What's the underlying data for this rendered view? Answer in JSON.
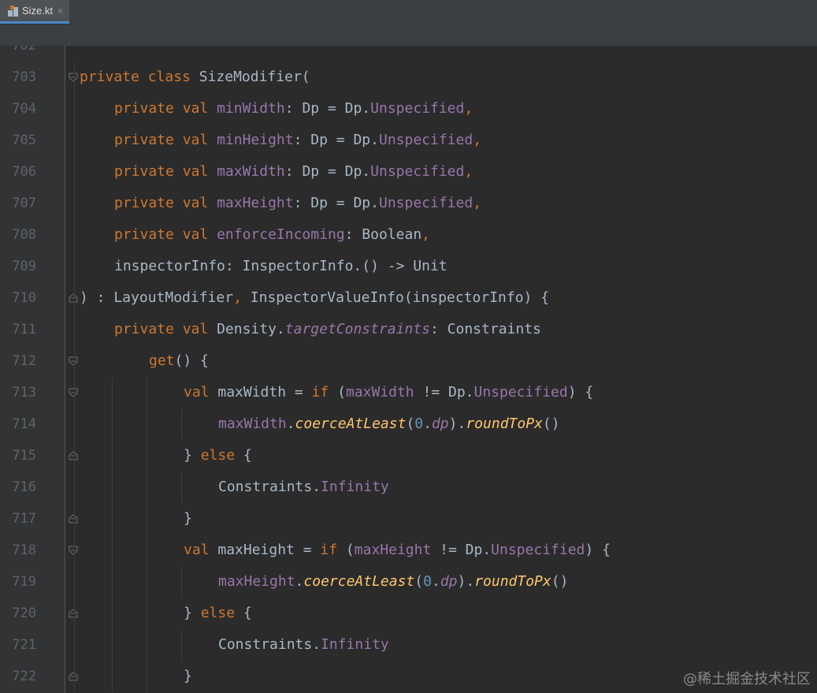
{
  "tab": {
    "filename": "Size.kt",
    "close_glyph": "×",
    "icon": "kotlin-file-icon"
  },
  "colors": {
    "keyword": "#cc7832",
    "property": "#9876aa",
    "function_italic": "#ffc66d",
    "plain": "#a9b7c6",
    "number": "#6897bb",
    "line_number": "#606366"
  },
  "watermark": "@稀土掘金技术社区",
  "editor": {
    "partial_top_line_number": "702",
    "lines": [
      {
        "number": "703",
        "indent": 0,
        "fold": "open",
        "tokens": [
          {
            "t": "private ",
            "c": "kw"
          },
          {
            "t": "class ",
            "c": "kw"
          },
          {
            "t": "SizeModifier(",
            "c": "pl"
          }
        ]
      },
      {
        "number": "704",
        "indent": 1,
        "fold": "",
        "tokens": [
          {
            "t": "private ",
            "c": "kw"
          },
          {
            "t": "val ",
            "c": "kw"
          },
          {
            "t": "minWidth",
            "c": "pr"
          },
          {
            "t": ": Dp = Dp.",
            "c": "pl"
          },
          {
            "t": "Unspecified",
            "c": "pr"
          },
          {
            "t": ",",
            "c": "kw"
          }
        ]
      },
      {
        "number": "705",
        "indent": 1,
        "fold": "",
        "tokens": [
          {
            "t": "private ",
            "c": "kw"
          },
          {
            "t": "val ",
            "c": "kw"
          },
          {
            "t": "minHeight",
            "c": "pr"
          },
          {
            "t": ": Dp = Dp.",
            "c": "pl"
          },
          {
            "t": "Unspecified",
            "c": "pr"
          },
          {
            "t": ",",
            "c": "kw"
          }
        ]
      },
      {
        "number": "706",
        "indent": 1,
        "fold": "",
        "tokens": [
          {
            "t": "private ",
            "c": "kw"
          },
          {
            "t": "val ",
            "c": "kw"
          },
          {
            "t": "maxWidth",
            "c": "pr"
          },
          {
            "t": ": Dp = Dp.",
            "c": "pl"
          },
          {
            "t": "Unspecified",
            "c": "pr"
          },
          {
            "t": ",",
            "c": "kw"
          }
        ]
      },
      {
        "number": "707",
        "indent": 1,
        "fold": "",
        "tokens": [
          {
            "t": "private ",
            "c": "kw"
          },
          {
            "t": "val ",
            "c": "kw"
          },
          {
            "t": "maxHeight",
            "c": "pr"
          },
          {
            "t": ": Dp = Dp.",
            "c": "pl"
          },
          {
            "t": "Unspecified",
            "c": "pr"
          },
          {
            "t": ",",
            "c": "kw"
          }
        ]
      },
      {
        "number": "708",
        "indent": 1,
        "fold": "",
        "tokens": [
          {
            "t": "private ",
            "c": "kw"
          },
          {
            "t": "val ",
            "c": "kw"
          },
          {
            "t": "enforceIncoming",
            "c": "pr"
          },
          {
            "t": ": Boolean",
            "c": "pl"
          },
          {
            "t": ",",
            "c": "kw"
          }
        ]
      },
      {
        "number": "709",
        "indent": 1,
        "fold": "",
        "tokens": [
          {
            "t": "inspectorInfo: InspectorInfo.() -> Unit",
            "c": "pl"
          }
        ]
      },
      {
        "number": "710",
        "indent": 0,
        "fold": "close",
        "tokens": [
          {
            "t": ") : LayoutModifier",
            "c": "pl"
          },
          {
            "t": ", ",
            "c": "kw"
          },
          {
            "t": "InspectorValueInfo(inspectorInfo) {",
            "c": "pl"
          }
        ]
      },
      {
        "number": "711",
        "indent": 1,
        "fold": "",
        "tokens": [
          {
            "t": "private ",
            "c": "kw"
          },
          {
            "t": "val ",
            "c": "kw"
          },
          {
            "t": "Density.",
            "c": "pl"
          },
          {
            "t": "targetConstraints",
            "c": "pri"
          },
          {
            "t": ": Constraints",
            "c": "pl"
          }
        ]
      },
      {
        "number": "712",
        "indent": 2,
        "fold": "open",
        "tokens": [
          {
            "t": "get",
            "c": "kw"
          },
          {
            "t": "() {",
            "c": "pl"
          }
        ]
      },
      {
        "number": "713",
        "indent": 3,
        "fold": "open",
        "tokens": [
          {
            "t": "val ",
            "c": "kw"
          },
          {
            "t": "maxWidth = ",
            "c": "pl"
          },
          {
            "t": "if ",
            "c": "kw"
          },
          {
            "t": "(",
            "c": "pl"
          },
          {
            "t": "maxWidth",
            "c": "pr"
          },
          {
            "t": " != Dp.",
            "c": "pl"
          },
          {
            "t": "Unspecified",
            "c": "pr"
          },
          {
            "t": ") {",
            "c": "pl"
          }
        ]
      },
      {
        "number": "714",
        "indent": 4,
        "fold": "",
        "tokens": [
          {
            "t": "maxWidth",
            "c": "pr"
          },
          {
            "t": ".",
            "c": "pl"
          },
          {
            "t": "coerceAtLeast",
            "c": "fn"
          },
          {
            "t": "(",
            "c": "pl"
          },
          {
            "t": "0",
            "c": "nu"
          },
          {
            "t": ".",
            "c": "pl"
          },
          {
            "t": "dp",
            "c": "pri"
          },
          {
            "t": ").",
            "c": "pl"
          },
          {
            "t": "roundToPx",
            "c": "fn"
          },
          {
            "t": "()",
            "c": "pl"
          }
        ]
      },
      {
        "number": "715",
        "indent": 3,
        "fold": "close",
        "tokens": [
          {
            "t": "} ",
            "c": "pl"
          },
          {
            "t": "else ",
            "c": "kw"
          },
          {
            "t": "{",
            "c": "pl"
          }
        ]
      },
      {
        "number": "716",
        "indent": 4,
        "fold": "",
        "tokens": [
          {
            "t": "Constraints.",
            "c": "pl"
          },
          {
            "t": "Infinity",
            "c": "pr"
          }
        ]
      },
      {
        "number": "717",
        "indent": 3,
        "fold": "close",
        "tokens": [
          {
            "t": "}",
            "c": "pl"
          }
        ]
      },
      {
        "number": "718",
        "indent": 3,
        "fold": "open",
        "tokens": [
          {
            "t": "val ",
            "c": "kw"
          },
          {
            "t": "maxHeight = ",
            "c": "pl"
          },
          {
            "t": "if ",
            "c": "kw"
          },
          {
            "t": "(",
            "c": "pl"
          },
          {
            "t": "maxHeight",
            "c": "pr"
          },
          {
            "t": " != Dp.",
            "c": "pl"
          },
          {
            "t": "Unspecified",
            "c": "pr"
          },
          {
            "t": ") {",
            "c": "pl"
          }
        ]
      },
      {
        "number": "719",
        "indent": 4,
        "fold": "",
        "tokens": [
          {
            "t": "maxHeight",
            "c": "pr"
          },
          {
            "t": ".",
            "c": "pl"
          },
          {
            "t": "coerceAtLeast",
            "c": "fn"
          },
          {
            "t": "(",
            "c": "pl"
          },
          {
            "t": "0",
            "c": "nu"
          },
          {
            "t": ".",
            "c": "pl"
          },
          {
            "t": "dp",
            "c": "pri"
          },
          {
            "t": ").",
            "c": "pl"
          },
          {
            "t": "roundToPx",
            "c": "fn"
          },
          {
            "t": "()",
            "c": "pl"
          }
        ]
      },
      {
        "number": "720",
        "indent": 3,
        "fold": "close",
        "tokens": [
          {
            "t": "} ",
            "c": "pl"
          },
          {
            "t": "else ",
            "c": "kw"
          },
          {
            "t": "{",
            "c": "pl"
          }
        ]
      },
      {
        "number": "721",
        "indent": 4,
        "fold": "",
        "tokens": [
          {
            "t": "Constraints.",
            "c": "pl"
          },
          {
            "t": "Infinity",
            "c": "pr"
          }
        ]
      },
      {
        "number": "722",
        "indent": 3,
        "fold": "close",
        "tokens": [
          {
            "t": "}",
            "c": "pl"
          }
        ]
      }
    ]
  }
}
